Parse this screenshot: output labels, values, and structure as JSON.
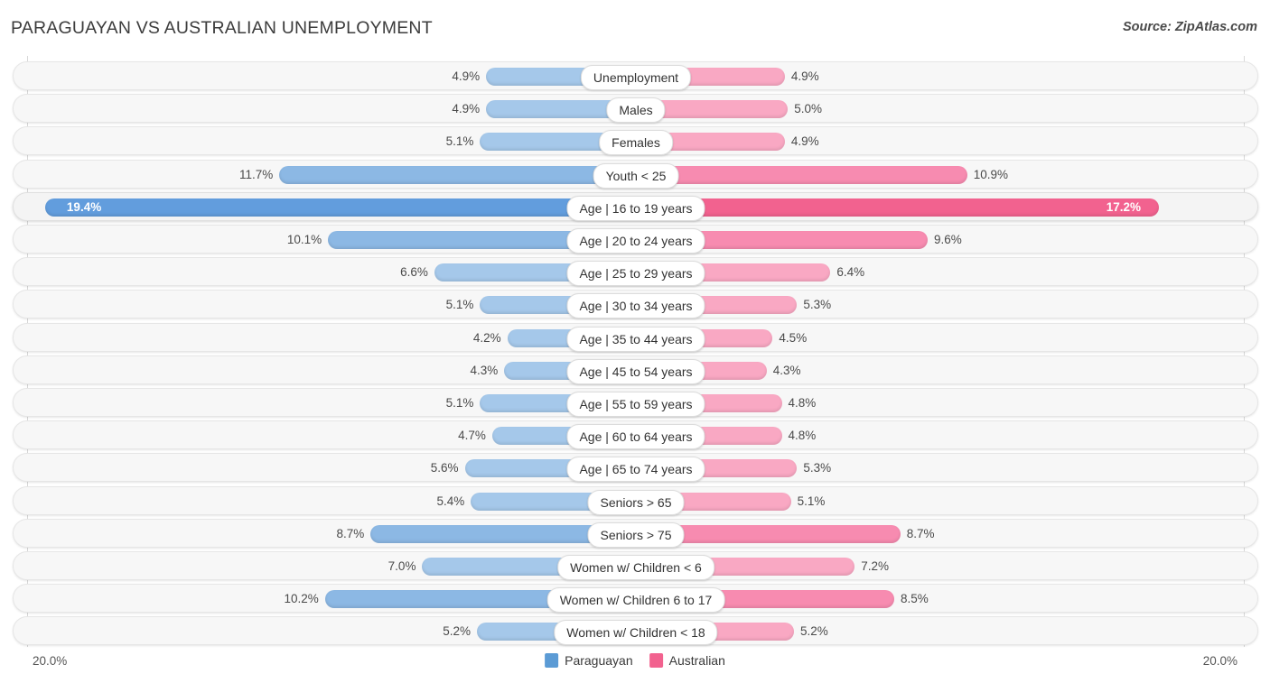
{
  "header": {
    "title": "PARAGUAYAN VS AUSTRALIAN UNEMPLOYMENT",
    "source": "Source: ZipAtlas.com"
  },
  "footer": {
    "axis_left": "20.0%",
    "axis_right": "20.0%",
    "legend": [
      {
        "label": "Paraguayan",
        "color": "#5b9bd5"
      },
      {
        "label": "Australian",
        "color": "#f2628f"
      }
    ]
  },
  "colors": {
    "blue_light": "#a5c8ea",
    "blue_mid": "#8cb8e4",
    "blue_strong": "#629ddd",
    "pink_light": "#f9a8c3",
    "pink_mid": "#f78bb0",
    "pink_strong": "#f2628f",
    "row_bg": "#f7f7f7",
    "row_border": "#e6e6e6",
    "axis_line": "#d8d8d8"
  },
  "chart_data": {
    "type": "bar",
    "subtype": "diverging-bar",
    "title": "PARAGUAYAN VS AUSTRALIAN UNEMPLOYMENT",
    "xlabel": "",
    "ylabel": "",
    "axis_max": 20.0,
    "axis_unit": "%",
    "xlim": [
      20.0,
      20.0
    ],
    "grid": false,
    "legend_position": "bottom-center",
    "categories": [
      "Unemployment",
      "Males",
      "Females",
      "Youth < 25",
      "Age | 16 to 19 years",
      "Age | 20 to 24 years",
      "Age | 25 to 29 years",
      "Age | 30 to 34 years",
      "Age | 35 to 44 years",
      "Age | 45 to 54 years",
      "Age | 55 to 59 years",
      "Age | 60 to 64 years",
      "Age | 65 to 74 years",
      "Seniors > 65",
      "Seniors > 75",
      "Women w/ Children < 6",
      "Women w/ Children 6 to 17",
      "Women w/ Children < 18"
    ],
    "series": [
      {
        "name": "Paraguayan",
        "color": "#5b9bd5",
        "values": [
          4.9,
          4.9,
          5.1,
          11.7,
          19.4,
          10.1,
          6.6,
          5.1,
          4.2,
          4.3,
          5.1,
          4.7,
          5.6,
          5.4,
          8.7,
          7.0,
          10.2,
          5.2
        ],
        "labels": [
          "4.9%",
          "4.9%",
          "5.1%",
          "11.7%",
          "19.4%",
          "10.1%",
          "6.6%",
          "5.1%",
          "4.2%",
          "4.3%",
          "5.1%",
          "4.7%",
          "5.6%",
          "5.4%",
          "8.7%",
          "7.0%",
          "10.2%",
          "5.2%"
        ]
      },
      {
        "name": "Australian",
        "color": "#f2628f",
        "values": [
          4.9,
          5.0,
          4.9,
          10.9,
          17.2,
          9.6,
          6.4,
          5.3,
          4.5,
          4.3,
          4.8,
          4.8,
          5.3,
          5.1,
          8.7,
          7.2,
          8.5,
          5.2
        ],
        "labels": [
          "4.9%",
          "5.0%",
          "4.9%",
          "10.9%",
          "17.2%",
          "9.6%",
          "6.4%",
          "5.3%",
          "4.5%",
          "4.3%",
          "4.8%",
          "4.8%",
          "5.3%",
          "5.1%",
          "8.7%",
          "7.2%",
          "8.5%",
          "5.2%"
        ]
      }
    ]
  },
  "rows": [
    {
      "label": "Unemployment",
      "left_value": "4.9%",
      "right_value": "4.9%",
      "left_num": 4.9,
      "right_num": 4.9,
      "style": "light",
      "inline": false
    },
    {
      "label": "Males",
      "left_value": "4.9%",
      "right_value": "5.0%",
      "left_num": 4.9,
      "right_num": 5.0,
      "style": "light",
      "inline": false
    },
    {
      "label": "Females",
      "left_value": "5.1%",
      "right_value": "4.9%",
      "left_num": 5.1,
      "right_num": 4.9,
      "style": "light",
      "inline": false
    },
    {
      "label": "Youth < 25",
      "left_value": "11.7%",
      "right_value": "10.9%",
      "left_num": 11.7,
      "right_num": 10.9,
      "style": "mid",
      "inline": false
    },
    {
      "label": "Age | 16 to 19 years",
      "left_value": "19.4%",
      "right_value": "17.2%",
      "left_num": 19.4,
      "right_num": 17.2,
      "style": "strong",
      "inline": true
    },
    {
      "label": "Age | 20 to 24 years",
      "left_value": "10.1%",
      "right_value": "9.6%",
      "left_num": 10.1,
      "right_num": 9.6,
      "style": "mid",
      "inline": false
    },
    {
      "label": "Age | 25 to 29 years",
      "left_value": "6.6%",
      "right_value": "6.4%",
      "left_num": 6.6,
      "right_num": 6.4,
      "style": "light",
      "inline": false
    },
    {
      "label": "Age | 30 to 34 years",
      "left_value": "5.1%",
      "right_value": "5.3%",
      "left_num": 5.1,
      "right_num": 5.3,
      "style": "light",
      "inline": false
    },
    {
      "label": "Age | 35 to 44 years",
      "left_value": "4.2%",
      "right_value": "4.5%",
      "left_num": 4.2,
      "right_num": 4.5,
      "style": "light",
      "inline": false
    },
    {
      "label": "Age | 45 to 54 years",
      "left_value": "4.3%",
      "right_value": "4.3%",
      "left_num": 4.3,
      "right_num": 4.3,
      "style": "light",
      "inline": false
    },
    {
      "label": "Age | 55 to 59 years",
      "left_value": "5.1%",
      "right_value": "4.8%",
      "left_num": 5.1,
      "right_num": 4.8,
      "style": "light",
      "inline": false
    },
    {
      "label": "Age | 60 to 64 years",
      "left_value": "4.7%",
      "right_value": "4.8%",
      "left_num": 4.7,
      "right_num": 4.8,
      "style": "light",
      "inline": false
    },
    {
      "label": "Age | 65 to 74 years",
      "left_value": "5.6%",
      "right_value": "5.3%",
      "left_num": 5.6,
      "right_num": 5.3,
      "style": "light",
      "inline": false
    },
    {
      "label": "Seniors > 65",
      "left_value": "5.4%",
      "right_value": "5.1%",
      "left_num": 5.4,
      "right_num": 5.1,
      "style": "light",
      "inline": false
    },
    {
      "label": "Seniors > 75",
      "left_value": "8.7%",
      "right_value": "8.7%",
      "left_num": 8.7,
      "right_num": 8.7,
      "style": "mid",
      "inline": false
    },
    {
      "label": "Women w/ Children < 6",
      "left_value": "7.0%",
      "right_value": "7.2%",
      "left_num": 7.0,
      "right_num": 7.2,
      "style": "light",
      "inline": false
    },
    {
      "label": "Women w/ Children 6 to 17",
      "left_value": "10.2%",
      "right_value": "8.5%",
      "left_num": 10.2,
      "right_num": 8.5,
      "style": "mid",
      "inline": false
    },
    {
      "label": "Women w/ Children < 18",
      "left_value": "5.2%",
      "right_value": "5.2%",
      "left_num": 5.2,
      "right_num": 5.2,
      "style": "light",
      "inline": false
    }
  ]
}
